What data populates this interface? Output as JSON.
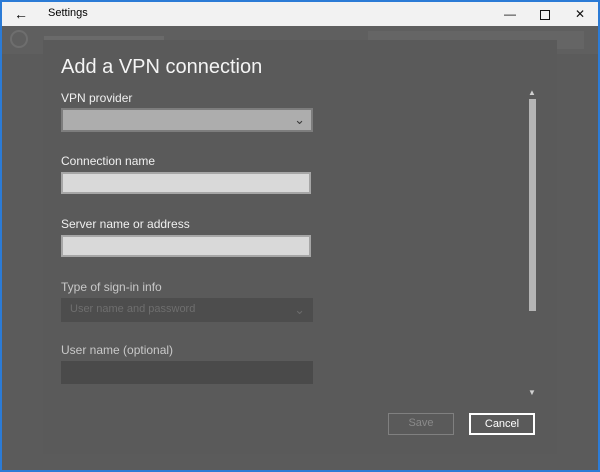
{
  "titlebar": {
    "back_glyph": "←",
    "title": "Settings",
    "min_glyph": "—",
    "close_glyph": "✕"
  },
  "dialog": {
    "heading": "Add a VPN connection",
    "vpn_provider": {
      "label": "VPN provider",
      "value": ""
    },
    "connection_name": {
      "label": "Connection name",
      "value": ""
    },
    "server": {
      "label": "Server name or address",
      "value": ""
    },
    "signin_type": {
      "label": "Type of sign-in info",
      "value": "User name and password"
    },
    "username": {
      "label": "User name (optional)",
      "value": ""
    },
    "save_label": "Save",
    "cancel_label": "Cancel"
  },
  "icons": {
    "chevron": "⌄",
    "scroll_up": "▲",
    "scroll_down": "▼"
  },
  "colors": {
    "accent_border": "#2b7bd6",
    "dialog_bg": "#5a5a5a"
  }
}
